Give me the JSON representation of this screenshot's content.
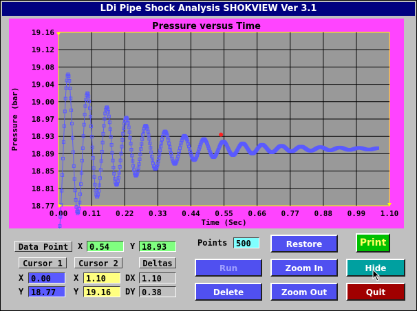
{
  "window": {
    "title": "LDi Pipe Shock Analysis SHOKVIEW Ver 3.1"
  },
  "chart_data": {
    "type": "scatter",
    "title": "Pressure versus Time",
    "xlabel": "Time (Sec)",
    "ylabel": "Pressure (bar)",
    "xlim": [
      0.0,
      1.1
    ],
    "ylim": [
      18.77,
      19.16
    ],
    "x_ticks": [
      "0.00",
      "0.11",
      "0.22",
      "0.33",
      "0.44",
      "0.55",
      "0.66",
      "0.77",
      "0.88",
      "0.99",
      "1.10"
    ],
    "y_ticks": [
      "19.16",
      "19.12",
      "19.08",
      "19.04",
      "19.00",
      "18.97",
      "18.93",
      "18.89",
      "18.85",
      "18.81",
      "18.77"
    ],
    "grid": true,
    "background": "#999999",
    "series": [
      {
        "color": "#5a5aff",
        "marker": "square",
        "model": {
          "x_start": 0.0,
          "x_end": 1.06,
          "points": 500,
          "baseline": 18.898,
          "amplitude": 0.215,
          "period": 0.0645,
          "decay": 4.5,
          "phase": -1.57
        }
      }
    ],
    "highlight_point": {
      "x": 0.54,
      "y": 18.93,
      "color": "#ff2020"
    }
  },
  "controls": {
    "data_point_label": "Data Point",
    "dp_x_label": "X",
    "dp_x_value": "0.54",
    "dp_y_label": "Y",
    "dp_y_value": "18.93",
    "points_label": "Points",
    "points_value": "500",
    "cursor1_label": "Cursor 1",
    "cursor2_label": "Cursor 2",
    "deltas_label": "Deltas",
    "c1_x_label": "X",
    "c1_x_value": "0.00",
    "c1_y_label": "Y",
    "c1_y_value": "18.77",
    "c2_x_label": "X",
    "c2_x_value": "1.10",
    "c2_y_label": "Y",
    "c2_y_value": "19.16",
    "dx_label": "DX",
    "dx_value": "1.10",
    "dy_label": "DY",
    "dy_value": "0.38"
  },
  "buttons": {
    "restore": "Restore",
    "print": "Print",
    "run": "Run",
    "zoom_in": "Zoom In",
    "hide": "Hide",
    "delete": "Delete",
    "zoom_out": "Zoom Out",
    "quit": "Quit"
  },
  "colors": {
    "green_field": "#80ff80",
    "yellow_field": "#ffff80",
    "blue_field": "#5a5aff",
    "cyan_field": "#80ffff",
    "gray_field": "#c0c0c0"
  }
}
